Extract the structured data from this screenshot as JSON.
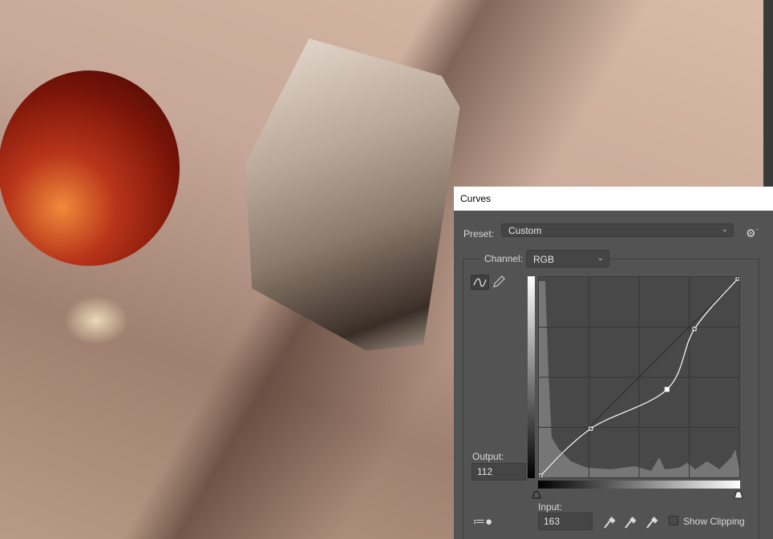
{
  "dialog": {
    "title": "Curves",
    "preset_label": "Preset:",
    "preset_value": "Custom",
    "channel_label": "Channel:",
    "channel_value": "RGB",
    "output_label": "Output:",
    "output_value": "112",
    "input_label": "Input:",
    "input_value": "163",
    "show_clipping_label": "Show Clipping",
    "show_clipping_checked": false
  },
  "curve": {
    "points": [
      [
        0,
        0
      ],
      [
        66,
        62
      ],
      [
        163,
        112
      ],
      [
        198,
        189
      ],
      [
        255,
        255
      ]
    ],
    "selected_index": 2
  },
  "colors": {
    "panel": "#535353",
    "curve": "#ffffff"
  }
}
